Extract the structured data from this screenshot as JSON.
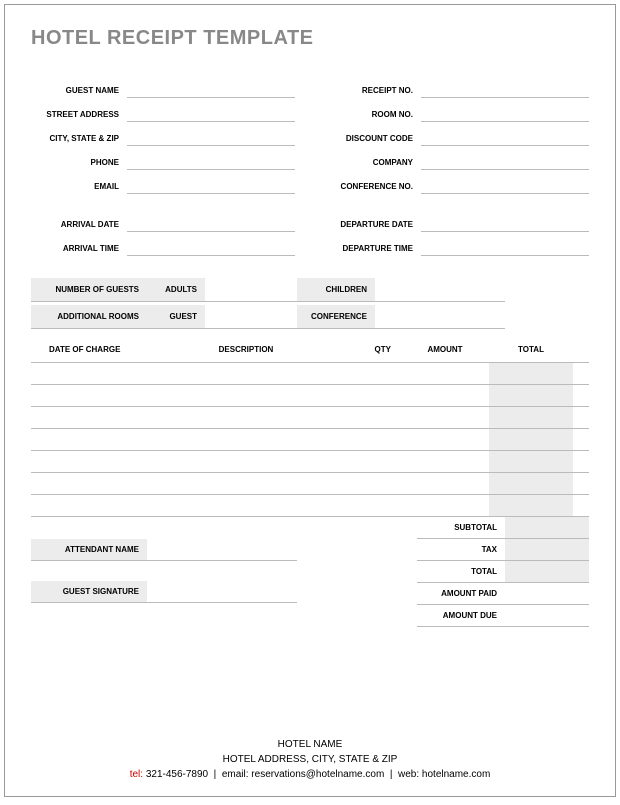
{
  "title": "HOTEL RECEIPT TEMPLATE",
  "guest": {
    "name_label": "GUEST NAME",
    "street_label": "STREET ADDRESS",
    "city_label": "CITY, STATE & ZIP",
    "phone_label": "PHONE",
    "email_label": "EMAIL"
  },
  "receipt": {
    "number_label": "RECEIPT NO.",
    "room_label": "ROOM NO.",
    "discount_label": "DISCOUNT CODE",
    "company_label": "COMPANY",
    "conference_label": "CONFERENCE NO."
  },
  "dates": {
    "arrival_date_label": "ARRIVAL DATE",
    "arrival_time_label": "ARRIVAL TIME",
    "departure_date_label": "DEPARTURE DATE",
    "departure_time_label": "DEPARTURE TIME"
  },
  "occupancy": {
    "num_guests_label": "NUMBER OF GUESTS",
    "adults_label": "ADULTS",
    "children_label": "CHILDREN",
    "additional_rooms_label": "ADDITIONAL ROOMS",
    "guest_label": "GUEST",
    "conference_label": "CONFERENCE"
  },
  "charges": {
    "date_header": "DATE OF CHARGE",
    "description_header": "DESCRIPTION",
    "qty_header": "QTY",
    "amount_header": "AMOUNT",
    "total_header": "TOTAL",
    "rows": [
      "",
      "",
      "",
      "",
      "",
      "",
      ""
    ]
  },
  "summary": {
    "subtotal_label": "SUBTOTAL",
    "tax_label": "TAX",
    "total_label": "TOTAL",
    "amount_paid_label": "AMOUNT PAID",
    "amount_due_label": "AMOUNT DUE"
  },
  "signatures": {
    "attendant_label": "ATTENDANT NAME",
    "guest_sig_label": "GUEST SIGNATURE"
  },
  "footer": {
    "hotel_name": "HOTEL NAME",
    "hotel_address": "HOTEL ADDRESS, CITY, STATE & ZIP",
    "tel_label": "tel:",
    "tel": "321-456-7890",
    "email_label": "email:",
    "email": "reservations@hotelname.com",
    "web_label": "web:",
    "web": "hotelname.com"
  }
}
